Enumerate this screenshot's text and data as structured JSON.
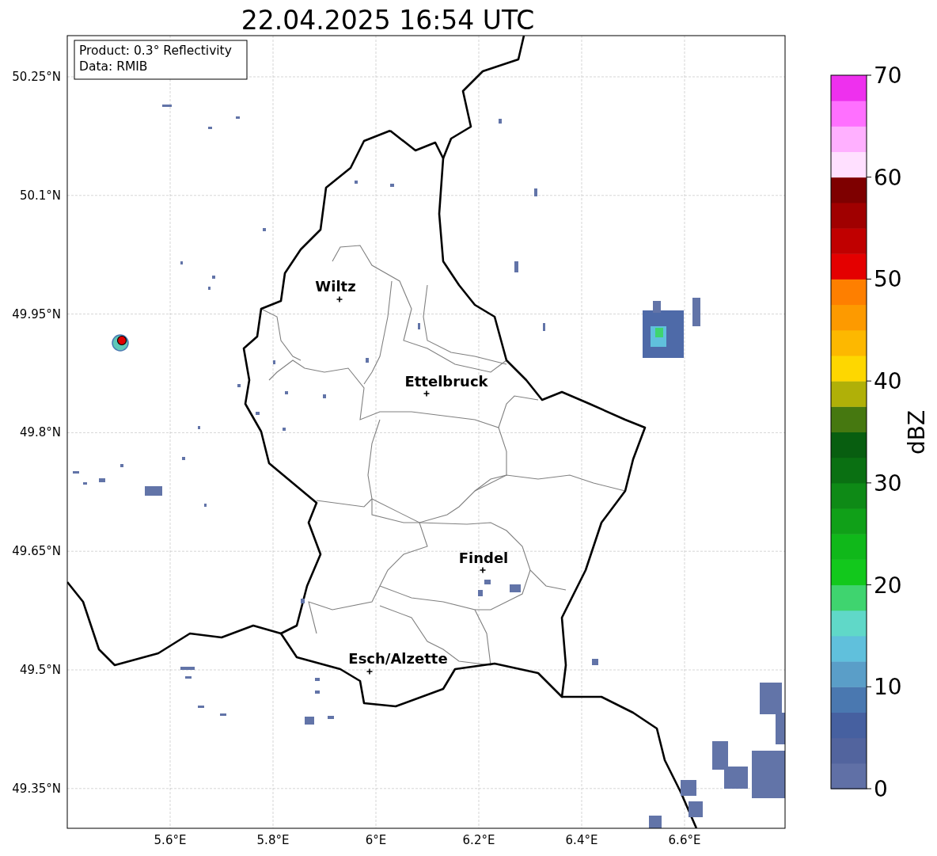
{
  "title": "22.04.2025 16:54 UTC",
  "info_box": [
    "Product: 0.3° Reflectivity",
    "Data: RMIB"
  ],
  "map": {
    "cities": [
      "Wiltz",
      "Ettelbruck",
      "Findel",
      "Esch/Alzette"
    ],
    "x_ticks": [
      "5.6°E",
      "5.8°E",
      "6°E",
      "6.2°E",
      "6.4°E",
      "6.6°E"
    ],
    "y_ticks": [
      "50.25°N",
      "50.1°N",
      "49.95°N",
      "49.8°N",
      "49.65°N",
      "49.5°N",
      "49.35°N"
    ]
  },
  "colorbar": {
    "label": "dBZ",
    "ticks": [
      "70",
      "60",
      "50",
      "40",
      "30",
      "20",
      "10",
      "0"
    ],
    "bins": [
      {
        "color": "#6070a6"
      },
      {
        "color": "#52649e"
      },
      {
        "color": "#4660a0"
      },
      {
        "color": "#4a78b0"
      },
      {
        "color": "#5a9ec8"
      },
      {
        "color": "#60c0dc"
      },
      {
        "color": "#60d8c8"
      },
      {
        "color": "#3fd46f"
      },
      {
        "color": "#12c81c"
      },
      {
        "color": "#10b81a"
      },
      {
        "color": "#10a018"
      },
      {
        "color": "#0e8a16"
      },
      {
        "color": "#0a7012"
      },
      {
        "color": "#085e10"
      },
      {
        "color": "#467810"
      },
      {
        "color": "#b0b008"
      },
      {
        "color": "#fed700"
      },
      {
        "color": "#fdb800"
      },
      {
        "color": "#fd9a00"
      },
      {
        "color": "#fe7f00"
      },
      {
        "color": "#e40000"
      },
      {
        "color": "#c00000"
      },
      {
        "color": "#a00000"
      },
      {
        "color": "#7e0000"
      },
      {
        "color": "#ffe0ff"
      },
      {
        "color": "#ffb0ff"
      },
      {
        "color": "#ff70ff"
      },
      {
        "color": "#ee30ee"
      }
    ]
  }
}
